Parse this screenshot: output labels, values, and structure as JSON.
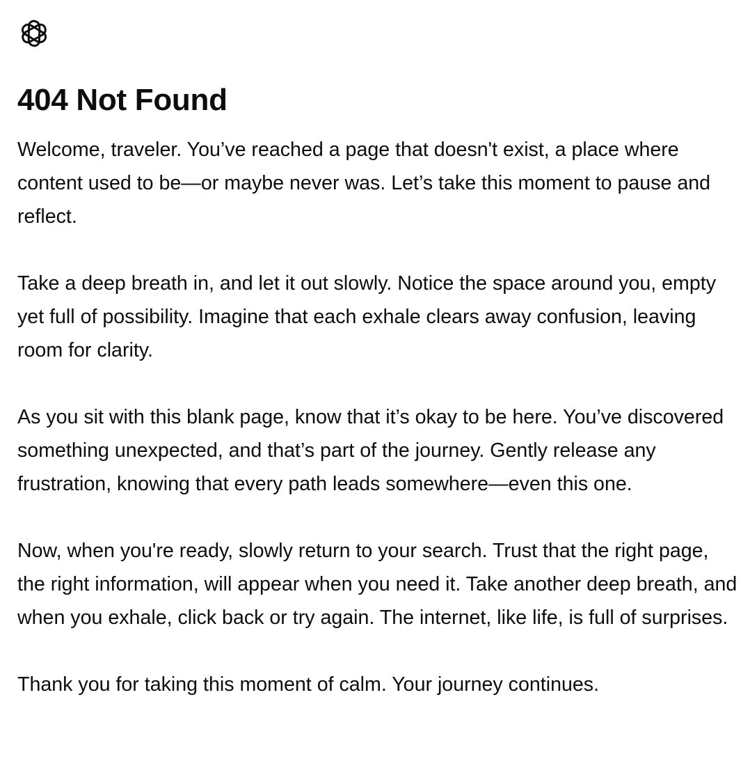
{
  "header": {
    "logo_icon": "openai-logo-icon",
    "title": "404 Not Found"
  },
  "main": {
    "paragraphs": [
      "Welcome, traveler. You’ve reached a page that doesn't exist, a place where content used to be—or maybe never was. Let’s take this moment to pause and reflect.",
      "Take a deep breath in, and let it out slowly. Notice the space around you, empty yet full of possibility. Imagine that each exhale clears away confusion, leaving room for clarity.",
      "As you sit with this blank page, know that it’s okay to be here. You’ve discovered something unexpected, and that’s part of the journey. Gently release any frustration, knowing that every path leads somewhere—even this one.",
      "Now, when you're ready, slowly return to your search. Trust that the right page, the right information, will appear when you need it. Take another deep breath, and when you exhale, click back or try again. The internet, like life, is full of surprises.",
      "Thank you for taking this moment of calm. Your journey continues."
    ]
  },
  "colors": {
    "text": "#0d0d0d",
    "background": "#ffffff"
  }
}
